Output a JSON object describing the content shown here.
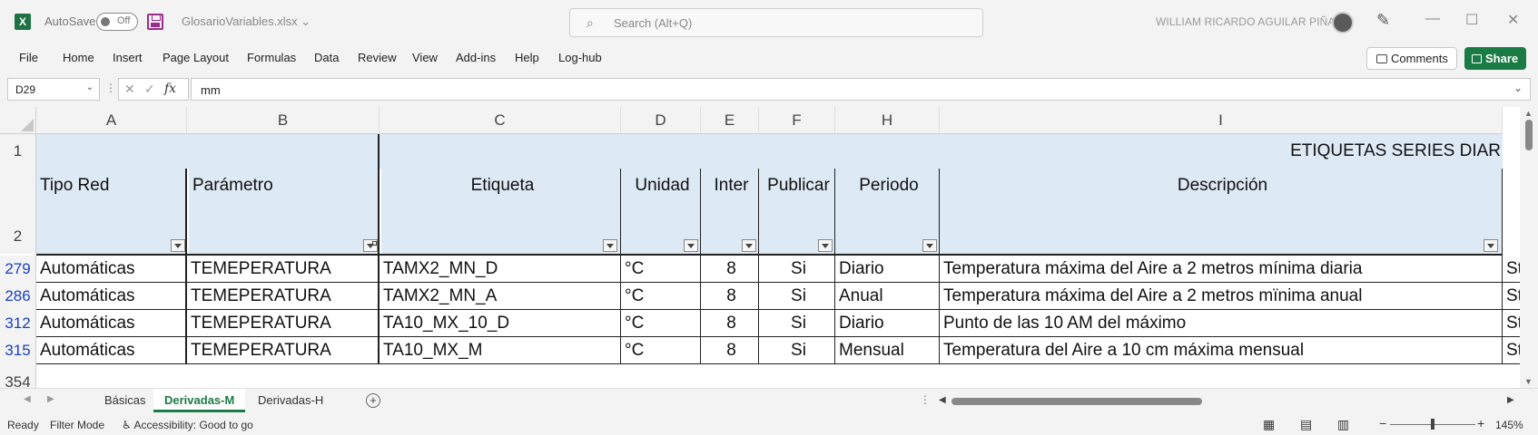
{
  "titlebar": {
    "app_icon": "excel-icon",
    "autosave_label": "AutoSave",
    "autosave_state": "Off",
    "filename": "GlosarioVariables.xlsx",
    "search_placeholder": "Search (Alt+Q)",
    "user_name": "WILLIAM RICARDO AGUILAR PIÑA"
  },
  "ribbon": {
    "tabs": [
      "File",
      "Home",
      "Insert",
      "Page Layout",
      "Formulas",
      "Data",
      "Review",
      "View",
      "Add-ins",
      "Help",
      "Log-hub"
    ],
    "comments_label": "Comments",
    "share_label": "Share"
  },
  "formula_bar": {
    "name_box": "D29",
    "formula": "mm",
    "fx": "fx"
  },
  "grid": {
    "columns": [
      "A",
      "B",
      "C",
      "D",
      "E",
      "F",
      "H",
      "I"
    ],
    "row1": {
      "num": "1",
      "banner": "ETIQUETAS SERIES DIAR"
    },
    "row2": {
      "num": "2",
      "headers": [
        "Tipo Red",
        "Parámetro",
        "Etiqueta",
        "Unidad",
        "Inter",
        "Publicar",
        "Periodo",
        "Descripción"
      ]
    },
    "rows": [
      {
        "num": "279",
        "cells": [
          "Automáticas",
          "TEMEPERATURA",
          "TAMX2_MN_D",
          "°C",
          "8",
          "Si",
          "Diario",
          "Temperatura máxima del Aire a 2 metros mínima diaria",
          "St"
        ]
      },
      {
        "num": "286",
        "cells": [
          "Automáticas",
          "TEMEPERATURA",
          "TAMX2_MN_A",
          "°C",
          "8",
          "Si",
          "Anual",
          "Temperatura máxima del Aire a 2 metros mïnima anual",
          "St"
        ]
      },
      {
        "num": "312",
        "cells": [
          "Automáticas",
          "TEMEPERATURA",
          "TA10_MX_10_D",
          "°C",
          "8",
          "Si",
          "Diario",
          "Punto de las 10 AM del máximo",
          "St"
        ]
      },
      {
        "num": "315",
        "cells": [
          "Automáticas",
          "TEMEPERATURA",
          "TA10_MX_M",
          "°C",
          "8",
          "Si",
          "Mensual",
          "Temperatura del Aire a 10 cm máxima mensual",
          "St"
        ]
      }
    ],
    "partial_row_num": "354"
  },
  "sheets": {
    "tabs": [
      "Básicas",
      "Derivadas-M",
      "Derivadas-H"
    ],
    "active": "Derivadas-M"
  },
  "status": {
    "ready": "Ready",
    "filter_mode": "Filter Mode",
    "accessibility": "Accessibility: Good to go",
    "zoom": "145%"
  },
  "colors": {
    "accent": "#1b7b45",
    "header_band": "#dde9f4",
    "row_number_filtered": "#1a3fc4"
  }
}
